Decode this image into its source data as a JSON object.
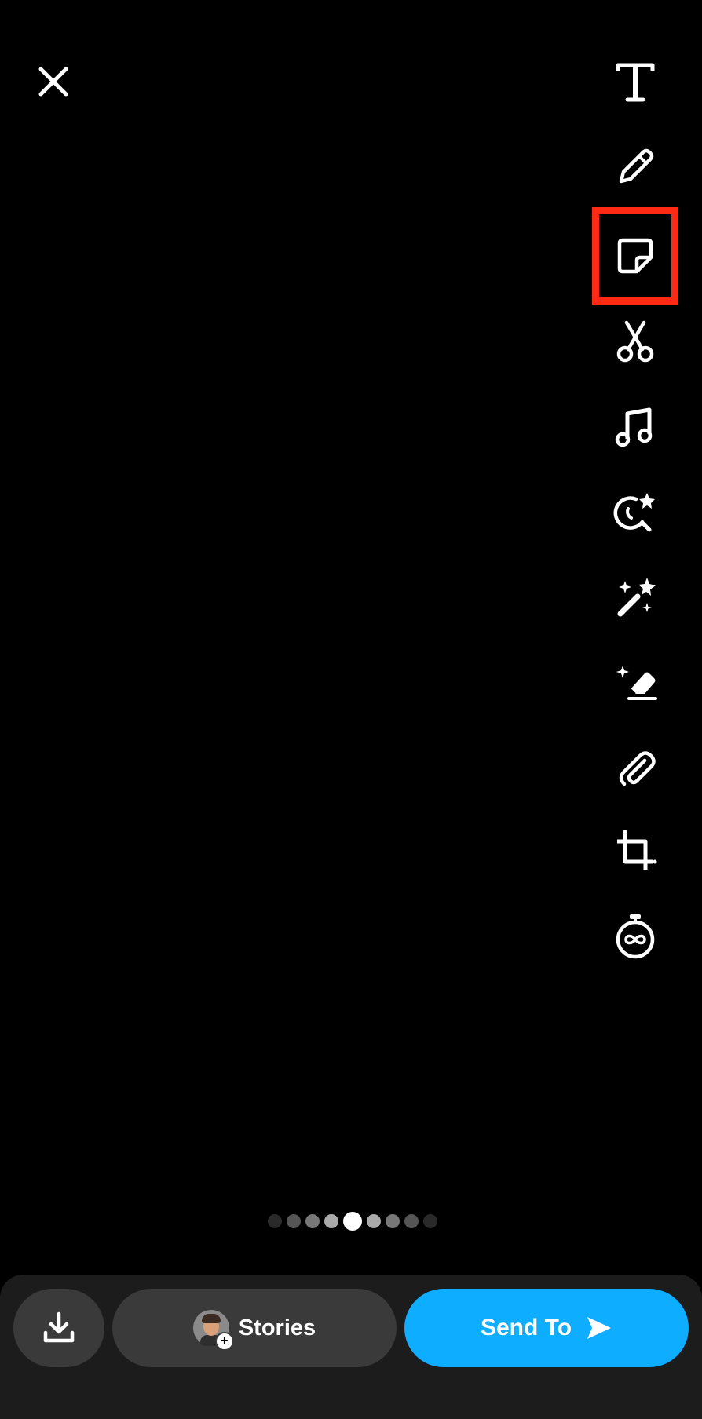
{
  "header": {
    "close_icon": "close-icon"
  },
  "toolbar": {
    "tools": [
      {
        "name": "text",
        "icon": "text-icon"
      },
      {
        "name": "draw",
        "icon": "pencil-icon"
      },
      {
        "name": "sticker",
        "icon": "sticker-icon",
        "highlighted": true,
        "highlight_color": "#ff2a14"
      },
      {
        "name": "scissors",
        "icon": "scissors-icon"
      },
      {
        "name": "music",
        "icon": "music-note-icon"
      },
      {
        "name": "lens",
        "icon": "lens-search-icon"
      },
      {
        "name": "magic",
        "icon": "magic-wand-icon"
      },
      {
        "name": "eraser",
        "icon": "eraser-icon"
      },
      {
        "name": "attachment",
        "icon": "paperclip-icon"
      },
      {
        "name": "crop",
        "icon": "crop-icon"
      },
      {
        "name": "timer",
        "icon": "timer-loop-icon"
      }
    ]
  },
  "pager": {
    "total": 9,
    "active_index": 4
  },
  "bottom_bar": {
    "save_icon": "download-icon",
    "stories_label": "Stories",
    "send_label": "Send To",
    "send_color": "#0eadff"
  }
}
